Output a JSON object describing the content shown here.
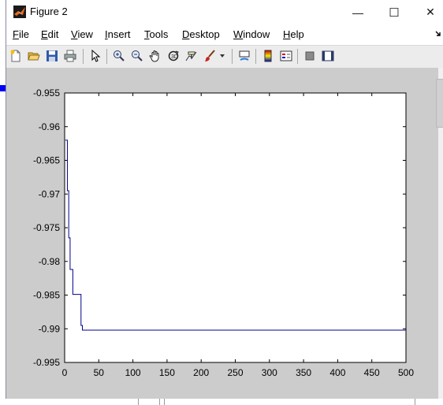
{
  "window": {
    "title": "Figure 2",
    "controls": {
      "minimize": "—",
      "maximize": "☐",
      "close": "✕"
    }
  },
  "menu": {
    "items": [
      {
        "label": "File",
        "underline": "F"
      },
      {
        "label": "Edit",
        "underline": "E"
      },
      {
        "label": "View",
        "underline": "V"
      },
      {
        "label": "Insert",
        "underline": "I"
      },
      {
        "label": "Tools",
        "underline": "T"
      },
      {
        "label": "Desktop",
        "underline": "D"
      },
      {
        "label": "Window",
        "underline": "W"
      },
      {
        "label": "Help",
        "underline": "H"
      }
    ]
  },
  "toolbar": {
    "icons": [
      "new-figure-icon",
      "open-file-icon",
      "save-icon",
      "print-icon",
      "pointer-icon",
      "zoom-in-icon",
      "zoom-out-icon",
      "pan-icon",
      "rotate-3d-icon",
      "data-cursor-icon",
      "brush-icon",
      "link-plot-icon",
      "colorbar-icon",
      "legend-icon",
      "hide-plot-tools-icon",
      "show-plot-tools-icon"
    ]
  },
  "colors": {
    "line": "#00008b",
    "axes_bg": "#ffffff",
    "figure_bg": "#cccccc"
  },
  "chart_data": {
    "type": "line",
    "title": "",
    "xlabel": "",
    "ylabel": "",
    "xlim": [
      0,
      500
    ],
    "ylim": [
      -0.995,
      -0.955
    ],
    "xticks": [
      0,
      50,
      100,
      150,
      200,
      250,
      300,
      350,
      400,
      450,
      500
    ],
    "yticks": [
      -0.955,
      -0.96,
      -0.965,
      -0.97,
      -0.975,
      -0.98,
      -0.985,
      -0.99,
      -0.995
    ],
    "xtick_labels": [
      "0",
      "50",
      "100",
      "150",
      "200",
      "250",
      "300",
      "350",
      "400",
      "450",
      "500"
    ],
    "ytick_labels": [
      "-0.955",
      "-0.96",
      "-0.965",
      "-0.97",
      "-0.975",
      "-0.98",
      "-0.985",
      "-0.99",
      "-0.995"
    ],
    "grid": false,
    "series": [
      {
        "step": true,
        "x": [
          1,
          4,
          6,
          8,
          12,
          24,
          26,
          500
        ],
        "y": [
          -0.962,
          -0.9695,
          -0.9765,
          -0.9812,
          -0.9849,
          -0.9895,
          -0.9902,
          -0.9902
        ]
      }
    ]
  }
}
